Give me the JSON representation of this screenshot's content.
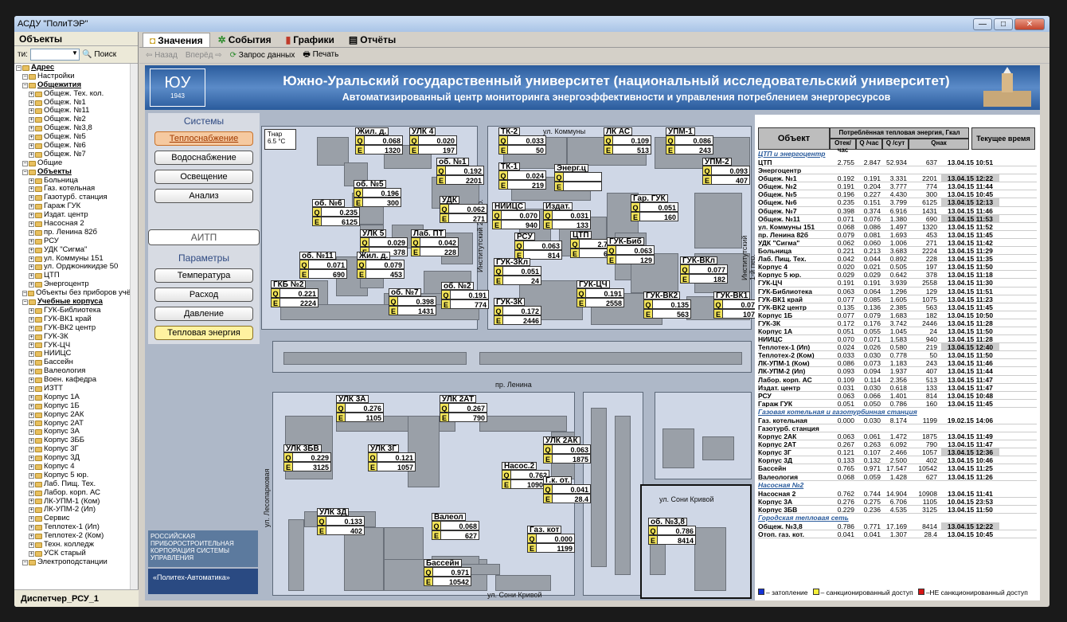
{
  "window": {
    "title": "АСДУ \"ПолиТЭР\""
  },
  "left": {
    "header": "Объекты",
    "search_label": "ти:",
    "search_btn": "Поиск",
    "bottom": "Диспетчер_РСУ_1",
    "tree": [
      "Адрес",
      "Настройки",
      "Общежития",
      "Общеж. Тех. кол.",
      "Общеж. №1",
      "Общеж. №11",
      "Общеж. №2",
      "Общеж. №3,8",
      "Общеж. №5",
      "Общеж. №6",
      "Общеж. №7",
      "Общие",
      "Объекты",
      "Больница",
      "Газ. котельная",
      "Газотурб. станция",
      "Гараж ГУК",
      "Издат. центр",
      "Насосная 2",
      "пр. Ленина 82б",
      "РСУ",
      "УДК \"Сигма\"",
      "ул. Коммуны 151",
      "ул. Орджоникидзе 50",
      "ЦТП",
      "Энергоцентр",
      "Объекты без приборов учё",
      "Учебные корпуса",
      "ГУК-Библиотека",
      "ГУК-ВК1 край",
      "ГУК-ВК2 центр",
      "ГУК-3К",
      "ГУК-ЦЧ",
      "НИИЦС",
      "Бассейн",
      "Валеология",
      "Воен. кафедра",
      "ИЗТТ",
      "Корпус 1А",
      "Корпус 1Б",
      "Корпус 2АК",
      "Корпус 2АТ",
      "Корпус 3А",
      "Корпус 3ББ",
      "Корпус 3Г",
      "Корпус 3Д",
      "Корпус 4",
      "Корпус 5 юр.",
      "Лаб. Пищ. Тех.",
      "Лабор. корп. АС",
      "ЛК-УПМ-1 (Ком)",
      "ЛК-УПМ-2 (Ип)",
      "Сервис",
      "Теплотех-1 (Ип)",
      "Теплотех-2 (Ком)",
      "Техн. колледж",
      "УСК старый",
      "Электроподстанции"
    ]
  },
  "tabs": [
    "Значения",
    "События",
    "Графики",
    "Отчёты"
  ],
  "toolbar": {
    "back": "Назад",
    "fwd": "Вперёд",
    "req": "Запрос данных",
    "print": "Печать"
  },
  "banner": {
    "t1": "Южно-Уральский государственный университет (национальный исследовательский университет)",
    "t2": "Автоматизированный центр мониторинга энергоэффективности и управления потреблением энергоресурсов",
    "year": "1943"
  },
  "nav": {
    "systems": "Системы",
    "b1": "Теплоснабжение",
    "b2": "Водоснабжение",
    "b3": "Освещение",
    "b4": "Анализ",
    "aitp": "АИТП",
    "params": "Параметры",
    "p1": "Температура",
    "p2": "Расход",
    "p3": "Давление",
    "p4": "Тепловая энергия"
  },
  "corp": {
    "c1": "РОССИЙСКАЯ ПРИБОРОСТРОИТЕЛЬНАЯ КОРПОРАЦИЯ СИСТЕМЫ УПРАВЛЕНИЯ",
    "c2": "«Политех-Автоматика»"
  },
  "tnar": {
    "label": "Тнар",
    "value": "6.5 °C"
  },
  "streets": [
    "ул. Коммуны",
    "Институтский 2-й пер.",
    "Институтский 1-й пер.",
    "пр. Ленина",
    "ул. Лесопарковая",
    "ул. Сони Кривой",
    "ул. Сони Кривой"
  ],
  "meters": [
    {
      "n": "Жил. д.",
      "q": "0.068",
      "e": "1320"
    },
    {
      "n": "УЛК 4",
      "q": "0.020",
      "e": "197"
    },
    {
      "n": "ТК-2",
      "q": "0.033",
      "e": "50"
    },
    {
      "n": "ЛК АС",
      "q": "0.109",
      "e": "513"
    },
    {
      "n": "УПМ-1",
      "q": "0.086",
      "e": "243"
    },
    {
      "n": "об. №1",
      "q": "0.192",
      "e": "2201"
    },
    {
      "n": "ТК-1",
      "q": "0.024",
      "e": "219"
    },
    {
      "n": "Энерг.ц",
      "q": "",
      "e": ""
    },
    {
      "n": "УПМ-2",
      "q": "0.093",
      "e": "407"
    },
    {
      "n": "об. №5",
      "q": "0.196",
      "e": "300"
    },
    {
      "n": "об. №6",
      "q": "0.235",
      "e": "6125"
    },
    {
      "n": "УДК",
      "q": "0.062",
      "e": "271"
    },
    {
      "n": "НИИЦС",
      "q": "0.070",
      "e": "940"
    },
    {
      "n": "Издат.",
      "q": "0.031",
      "e": "133"
    },
    {
      "n": "Гар. ГУК",
      "q": "0.051",
      "e": "160"
    },
    {
      "n": "УЛК 5",
      "q": "0.029",
      "e": "378"
    },
    {
      "n": "Лаб. ПТ",
      "q": "0.042",
      "e": "228"
    },
    {
      "n": "РСУ",
      "q": "0.063",
      "e": "814"
    },
    {
      "n": "ЦТП",
      "q": "2.755",
      "e": "637"
    },
    {
      "n": "ГУК-Биб",
      "q": "0.063",
      "e": "129"
    },
    {
      "n": "об. №11",
      "q": "0.071",
      "e": "690"
    },
    {
      "n": "Жил. д.",
      "q": "0.079",
      "e": "453"
    },
    {
      "n": "ГУК-ЗКл",
      "q": "0.051",
      "e": "24"
    },
    {
      "n": "ГУК-ВКл",
      "q": "0.077",
      "e": "182"
    },
    {
      "n": "ГКБ №2",
      "q": "0.221",
      "e": "2224"
    },
    {
      "n": "об. №7",
      "q": "0.398",
      "e": "1431"
    },
    {
      "n": "об. №2",
      "q": "0.191",
      "e": "774"
    },
    {
      "n": "ГУК-ЦЧ",
      "q": "0.191",
      "e": "2558"
    },
    {
      "n": "ГУК-ВК2",
      "q": "0.135",
      "e": "563"
    },
    {
      "n": "ГУК-ВК1",
      "q": "0.077",
      "e": "1075"
    },
    {
      "n": "ГУК-3К",
      "q": "0.172",
      "e": "2446"
    },
    {
      "n": "УЛК 3А",
      "q": "0.276",
      "e": "1105"
    },
    {
      "n": "УЛК 2АТ",
      "q": "0.267",
      "e": "790"
    },
    {
      "n": "УЛК 2АК",
      "q": "0.063",
      "e": "1875"
    },
    {
      "n": "УЛК 3БВ",
      "q": "0.229",
      "e": "3125"
    },
    {
      "n": "УЛК 3Г",
      "q": "0.121",
      "e": "1057"
    },
    {
      "n": "Насос.2",
      "q": "0.762",
      "e": "10908"
    },
    {
      "n": "Г.к. от.",
      "q": "0.041",
      "e": "28.4"
    },
    {
      "n": "УЛК 3Д",
      "q": "0.133",
      "e": "402"
    },
    {
      "n": "Валеол",
      "q": "0.068",
      "e": "627"
    },
    {
      "n": "Газ. кот",
      "q": "0.000",
      "e": "1199"
    },
    {
      "n": "Бассейн",
      "q": "0.971",
      "e": "10542"
    },
    {
      "n": "об. №3,8",
      "q": "0.786",
      "e": "8414"
    }
  ],
  "table": {
    "h_obj": "Объект",
    "h_group": "Потреблённая тепловая энергия, Гкал",
    "h_c1": "Отек/час",
    "h_c2": "Q /час",
    "h_c3": "Q /сут",
    "h_c4": "Qнак",
    "h_time": "Текущее время",
    "rows": [
      {
        "s": "ЦТП и энергоцентр"
      },
      {
        "n": "ЦТП",
        "a": "2.755",
        "b": "2.847",
        "c": "52.934",
        "d": "637",
        "t": "13.04.15 10:51"
      },
      {
        "n": "Энергоцентр",
        "a": "",
        "b": "",
        "c": "",
        "d": "",
        "t": ""
      },
      {
        "n": "Общеж. №1",
        "a": "0.192",
        "b": "0.191",
        "c": "3.331",
        "d": "2201",
        "t": "13.04.15 12:22",
        "h": 1
      },
      {
        "n": "Общеж. №2",
        "a": "0.191",
        "b": "0.204",
        "c": "3.777",
        "d": "774",
        "t": "13.04.15 11:44"
      },
      {
        "n": "Общеж. №5",
        "a": "0.196",
        "b": "0.227",
        "c": "4.430",
        "d": "300",
        "t": "13.04.15 10:45"
      },
      {
        "n": "Общеж. №6",
        "a": "0.235",
        "b": "0.151",
        "c": "3.799",
        "d": "6125",
        "t": "13.04.15 12:13",
        "h": 1
      },
      {
        "n": "Общеж. №7",
        "a": "0.398",
        "b": "0.374",
        "c": "6.916",
        "d": "1431",
        "t": "13.04.15 11:46"
      },
      {
        "n": "Общеж. №11",
        "a": "0.071",
        "b": "0.076",
        "c": "1.380",
        "d": "690",
        "t": "13.04.15 11:53",
        "h": 1
      },
      {
        "n": "ул. Коммуны 151",
        "a": "0.068",
        "b": "0.086",
        "c": "1.497",
        "d": "1320",
        "t": "13.04.15 11:52"
      },
      {
        "n": "пр. Ленина 82б",
        "a": "0.079",
        "b": "0.081",
        "c": "1.693",
        "d": "453",
        "t": "13.04.15 11:45"
      },
      {
        "n": "УДК \"Сигма\"",
        "a": "0.062",
        "b": "0.060",
        "c": "1.006",
        "d": "271",
        "t": "13.04.15 11:42"
      },
      {
        "n": "Больница",
        "a": "0.221",
        "b": "0.213",
        "c": "3.683",
        "d": "2224",
        "t": "13.04.15 11:29"
      },
      {
        "n": "Лаб. Пищ. Тех.",
        "a": "0.042",
        "b": "0.044",
        "c": "0.892",
        "d": "228",
        "t": "13.04.15 11:35"
      },
      {
        "n": "Корпус 4",
        "a": "0.020",
        "b": "0.021",
        "c": "0.505",
        "d": "197",
        "t": "13.04.15 11:50"
      },
      {
        "n": "Корпус 5 юр.",
        "a": "0.029",
        "b": "0.029",
        "c": "0.642",
        "d": "378",
        "t": "13.04.15 11:18"
      },
      {
        "n": "ГУК-ЦЧ",
        "a": "0.191",
        "b": "0.191",
        "c": "3.939",
        "d": "2558",
        "t": "13.04.15 11:30"
      },
      {
        "n": "ГУК-Библиотека",
        "a": "0.063",
        "b": "0.064",
        "c": "1.296",
        "d": "129",
        "t": "13.04.15 11:51"
      },
      {
        "n": "ГУК-ВК1 край",
        "a": "0.077",
        "b": "0.085",
        "c": "1.605",
        "d": "1075",
        "t": "13.04.15 11:23"
      },
      {
        "n": "ГУК-ВК2 центр",
        "a": "0.135",
        "b": "0.136",
        "c": "2.385",
        "d": "563",
        "t": "13.04.15 11:45"
      },
      {
        "n": "Корпус 1Б",
        "a": "0.077",
        "b": "0.079",
        "c": "1.683",
        "d": "182",
        "t": "13.04.15 10:50"
      },
      {
        "n": "ГУК-3К",
        "a": "0.172",
        "b": "0.176",
        "c": "3.742",
        "d": "2446",
        "t": "13.04.15 11:28"
      },
      {
        "n": "Корпус 1А",
        "a": "0.051",
        "b": "0.055",
        "c": "1.045",
        "d": "24",
        "t": "13.04.15 11:50"
      },
      {
        "n": "НИИЦС",
        "a": "0.070",
        "b": "0.071",
        "c": "1.583",
        "d": "940",
        "t": "13.04.15 11:28"
      },
      {
        "n": "Теплотех-1 (Ип)",
        "a": "0.024",
        "b": "0.026",
        "c": "0.580",
        "d": "219",
        "t": "13.04.15 12:40",
        "h": 1
      },
      {
        "n": "Теплотех-2 (Ком)",
        "a": "0.033",
        "b": "0.030",
        "c": "0.778",
        "d": "50",
        "t": "13.04.15 11:50"
      },
      {
        "n": "ЛК-УПМ-1 (Ком)",
        "a": "0.086",
        "b": "0.073",
        "c": "1.183",
        "d": "243",
        "t": "13.04.15 11:46"
      },
      {
        "n": "ЛК-УПМ-2 (Ип)",
        "a": "0.093",
        "b": "0.094",
        "c": "1.937",
        "d": "407",
        "t": "13.04.15 11:44"
      },
      {
        "n": "Лабор. корп. АС",
        "a": "0.109",
        "b": "0.114",
        "c": "2.356",
        "d": "513",
        "t": "13.04.15 11:47"
      },
      {
        "n": "Издат. центр",
        "a": "0.031",
        "b": "0.030",
        "c": "0.618",
        "d": "133",
        "t": "13.04.15 11:47"
      },
      {
        "n": "РСУ",
        "a": "0.063",
        "b": "0.066",
        "c": "1.401",
        "d": "814",
        "t": "13.04.15 10:48"
      },
      {
        "n": "Гараж ГУК",
        "a": "0.051",
        "b": "0.050",
        "c": "0.786",
        "d": "160",
        "t": "13.04.15 11:45"
      },
      {
        "s": "Газовая котельная и газотурбинная станция"
      },
      {
        "n": "Газ. котельная",
        "a": "0.000",
        "b": "0.030",
        "c": "8.174",
        "d": "1199",
        "t": "19.02.15 14:06"
      },
      {
        "n": "Газотурб. станция",
        "a": "",
        "b": "",
        "c": "",
        "d": "",
        "t": ""
      },
      {
        "n": "Корпус 2АК",
        "a": "0.063",
        "b": "0.061",
        "c": "1.472",
        "d": "1875",
        "t": "13.04.15 11:49"
      },
      {
        "n": "Корпус 2АТ",
        "a": "0.267",
        "b": "0.263",
        "c": "6.092",
        "d": "790",
        "t": "13.04.15 11:47"
      },
      {
        "n": "Корпус 3Г",
        "a": "0.121",
        "b": "0.107",
        "c": "2.466",
        "d": "1057",
        "t": "13.04.15 12:36",
        "h": 1
      },
      {
        "n": "Корпус 3Д",
        "a": "0.133",
        "b": "0.132",
        "c": "2.500",
        "d": "402",
        "t": "13.04.15 10:46"
      },
      {
        "n": "Бассейн",
        "a": "0.765",
        "b": "0.971",
        "c": "17.547",
        "d": "10542",
        "t": "13.04.15 11:25"
      },
      {
        "n": "Валеология",
        "a": "0.068",
        "b": "0.059",
        "c": "1.428",
        "d": "627",
        "t": "13.04.15 11:26"
      },
      {
        "s": "Насосная №2"
      },
      {
        "n": "Насосная 2",
        "a": "0.762",
        "b": "0.744",
        "c": "14.904",
        "d": "10908",
        "t": "13.04.15 11:41"
      },
      {
        "n": "Корпус 3А",
        "a": "0.276",
        "b": "0.275",
        "c": "6.706",
        "d": "1105",
        "t": "10.04.15 23:53"
      },
      {
        "n": "Корпус 3БВ",
        "a": "0.229",
        "b": "0.236",
        "c": "4.535",
        "d": "3125",
        "t": "13.04.15 11:50"
      },
      {
        "s": "Городская тепловая сеть"
      },
      {
        "n": "Общеж. №3,8",
        "a": "0.786",
        "b": "0.771",
        "c": "17.169",
        "d": "8414",
        "t": "13.04.15 12:22",
        "h": 1
      },
      {
        "n": "Отоп. газ. кот.",
        "a": "0.041",
        "b": "0.041",
        "c": "1.307",
        "d": "28.4",
        "t": "13.04.15 10:45"
      }
    ]
  },
  "legend": {
    "l1": "– затопление",
    "l2": "– санкционированный доступ",
    "l3": "–НЕ санкционированный доступ"
  },
  "colors": {
    "flood": "#1533d6",
    "auth": "#f5ef3a",
    "unauth": "#d61515"
  }
}
